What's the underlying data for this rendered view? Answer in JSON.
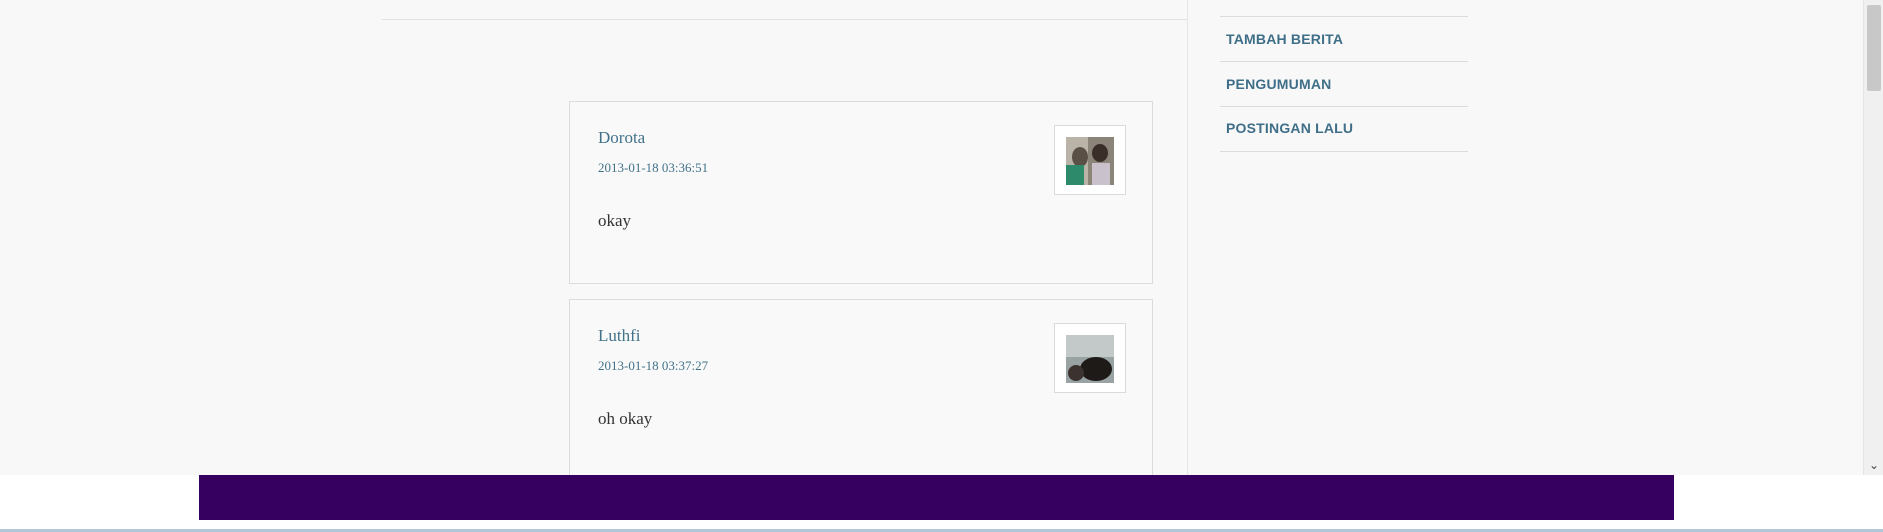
{
  "sidebar": {
    "items": [
      {
        "label": "TAMBAH BERITA"
      },
      {
        "label": "PENGUMUMAN"
      },
      {
        "label": "POSTINGAN LALU"
      }
    ]
  },
  "comments": [
    {
      "author": "Dorota",
      "timestamp": "2013-01-18 03:36:51",
      "text": "okay",
      "avatar": "user-photo-icon"
    },
    {
      "author": "Luthfi",
      "timestamp": "2013-01-18 03:37:27",
      "text": "oh okay",
      "avatar": "user-photo-icon"
    }
  ],
  "colors": {
    "link": "#41728a",
    "footer": "#360061",
    "background": "#f8f8f8"
  },
  "scrollbar": {
    "down_arrow": "⌄"
  }
}
